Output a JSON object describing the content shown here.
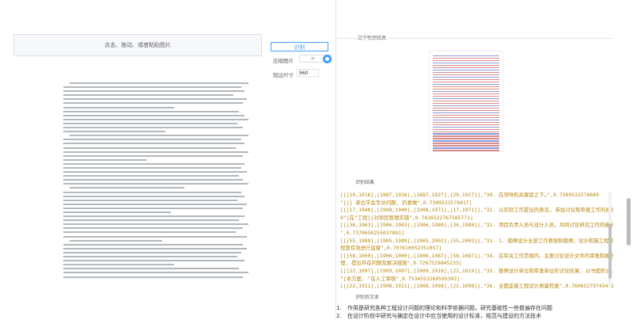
{
  "upload": {
    "label": "点击、拖动、或者粘贴图片"
  },
  "controls": {
    "recognize_button": "识别",
    "compress_label": "压缩图片",
    "compress_toggle_text": "开",
    "compress_on": true,
    "short_side_label": "短边尺寸",
    "short_side_value": "960"
  },
  "result": {
    "image_section_title": "文字检测结果",
    "json_section_title": "识别结果",
    "json_lines": [
      "[[[10,1916],[1887,1916],[1887,1927],[20,1927]],\"30. 在领导机关督促之下…\",0.7369532578849",
      "\"[[[ 单位学会专访问题, 仍要做\",0.7309522570417]",
      "[[[17,1940],[1908,1940],[1908,1971],[17,1971]],\"31. 以实际工作提出的意见, 参加讨论和审查工作的组织\",0.9…",
      "0\"[在\"工程][对项目管理实施\",0.7426522767585771]",
      "[[[36,1963],[1906,1963],[1906,1980],[36,1980]],\"32. 项目负责人员与设计人员，共同讨论研究工作的细节…",
      "\",0.7370650255037801]",
      "[[[55,1989],[1905,1989],[1905,2002],[55,2002]],\"33. 1. 勘察设计全部工作要按照勘察、设计和施工程序…",
      "程度有效进行监督\",0.707610052351057]",
      "[[[58,1000],[1906,1000],[1906,1087],[58,1087]],\"34. 在有关工作范围内，主要讨论设计文件的审查和报告…",
      "理, 提出存在问题及解决措施\",0.7267529845233]",
      "[[[22,1097],[1909,1097],[1909,1019],[22,1019]],\"35. 勘察设计单位和审查单位的讨论结果, 以书面形式…",
      "\"[本方面, \"在人工审核\",0.7534553269505392]",
      "[[[22,1911],[1908,1911],[1908,1098],[22,1098]],\"36. 全面监督工程设计质量检查\",0.760652797434215]"
    ],
    "text_section_title": "识别后文本",
    "text_lines": [
      {
        "num": "1.",
        "text": "作用是研究各种工程设计问题的理论和科学依据问题，研究基础性一些普遍存在问题"
      },
      {
        "num": "2.",
        "text": "在设计阶段中研究与确定在设计中应当使用的设计标准，规范与建设的方法技术"
      }
    ]
  }
}
